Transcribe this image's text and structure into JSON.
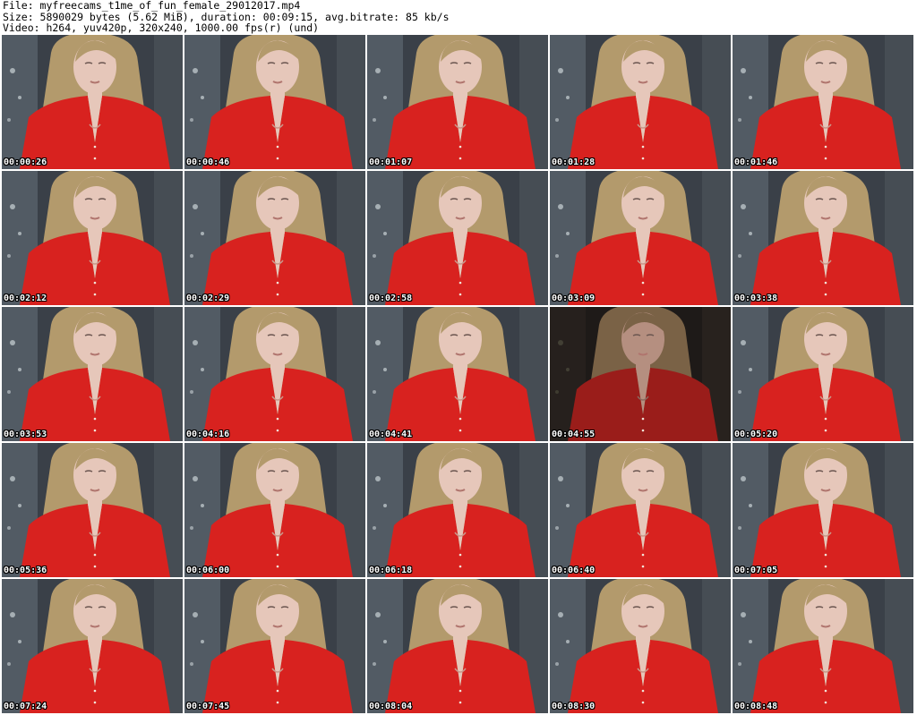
{
  "header": {
    "file_line": "File: myfreecams_t1me_of_fun_female_29012017.mp4",
    "size_line": "Size: 5890029 bytes (5.62 MiB), duration: 00:09:15, avg.bitrate: 85 kb/s",
    "video_line": "Video: h264, yuv420p, 320x240, 1000.00 fps(r) (und)"
  },
  "colors": {
    "shirt": "#d8221f",
    "hair": "#b39a6c",
    "skin": "#e6c7ba",
    "background": "#3a4048",
    "timestamp_text": "#ffffff"
  },
  "thumbnails": [
    {
      "timestamp": "00:00:26"
    },
    {
      "timestamp": "00:00:46"
    },
    {
      "timestamp": "00:01:07"
    },
    {
      "timestamp": "00:01:28"
    },
    {
      "timestamp": "00:01:46"
    },
    {
      "timestamp": "00:02:12"
    },
    {
      "timestamp": "00:02:29"
    },
    {
      "timestamp": "00:02:58"
    },
    {
      "timestamp": "00:03:09"
    },
    {
      "timestamp": "00:03:38"
    },
    {
      "timestamp": "00:03:53"
    },
    {
      "timestamp": "00:04:16"
    },
    {
      "timestamp": "00:04:41"
    },
    {
      "timestamp": "00:04:55",
      "dim": true
    },
    {
      "timestamp": "00:05:20"
    },
    {
      "timestamp": "00:05:36"
    },
    {
      "timestamp": "00:06:00"
    },
    {
      "timestamp": "00:06:18"
    },
    {
      "timestamp": "00:06:40"
    },
    {
      "timestamp": "00:07:05"
    },
    {
      "timestamp": "00:07:24"
    },
    {
      "timestamp": "00:07:45"
    },
    {
      "timestamp": "00:08:04"
    },
    {
      "timestamp": "00:08:30"
    },
    {
      "timestamp": "00:08:48"
    }
  ]
}
